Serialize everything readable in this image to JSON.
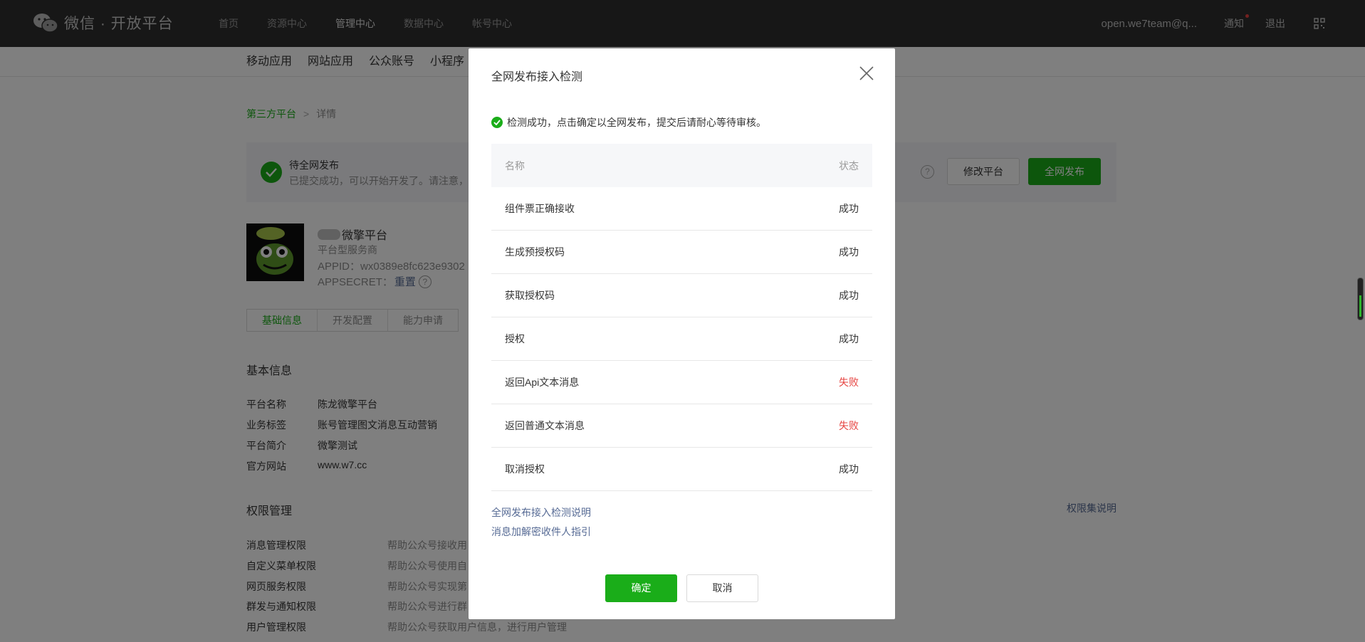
{
  "topbar": {
    "logo_text": "微信 · 开放平台",
    "nav": [
      "首页",
      "资源中心",
      "管理中心",
      "数据中心",
      "帐号中心"
    ],
    "active_nav": "管理中心",
    "account": "open.we7team@q...",
    "notify": "通知",
    "logout": "退出",
    "icons": {
      "logo": "wechat-logo-icon",
      "qr": "qrcode-icon"
    }
  },
  "subnav": [
    "移动应用",
    "网站应用",
    "公众账号",
    "小程序"
  ],
  "breadcrumb": {
    "home": "第三方平台",
    "sep": ">",
    "current": "详情"
  },
  "notice": {
    "title": "待全网发布",
    "desc": "已提交成功，可以开始开发了。请注意，",
    "help": "?",
    "modify_button": "修改平台",
    "publish_button": "全网发布"
  },
  "platform": {
    "name": "微擎平台",
    "type": "平台型服务商",
    "appid": "APPID：wx0389e8fc623e9302",
    "appsecret_label": "APPSECRET：",
    "appsecret_reset": "重置",
    "help": "?"
  },
  "tabs": [
    "基础信息",
    "开发配置",
    "能力申请"
  ],
  "basic_info": {
    "title": "基本信息",
    "rows": [
      {
        "k": "平台名称",
        "v": "陈龙微擎平台"
      },
      {
        "k": "业务标签",
        "v": "账号管理图文消息互动营销"
      },
      {
        "k": "平台简介",
        "v": "微擎测试"
      },
      {
        "k": "官方网站",
        "v": "www.w7.cc"
      }
    ]
  },
  "permissions": {
    "title": "权限管理",
    "help_link": "权限集说明",
    "rows": [
      {
        "k": "消息管理权限",
        "v": "帮助公众号接收用"
      },
      {
        "k": "自定义菜单权限",
        "v": "帮助公众号使用自"
      },
      {
        "k": "网页服务权限",
        "v": "帮助公众号实现第"
      },
      {
        "k": "群发与通知权限",
        "v": "帮助公众号进行群"
      },
      {
        "k": "用户管理权限",
        "v": "帮助公众号获取用户信息，进行用户管理"
      }
    ]
  },
  "modal": {
    "title": "全网发布接入检测",
    "status": "检测成功，点击确定以全网发布，提交后请耐心等待审核。",
    "table_header": {
      "name": "名称",
      "status": "状态"
    },
    "rows": [
      {
        "name": "组件票正确接收",
        "status": "成功",
        "fail": false
      },
      {
        "name": "生成预授权码",
        "status": "成功",
        "fail": false
      },
      {
        "name": "获取授权码",
        "status": "成功",
        "fail": false
      },
      {
        "name": "授权",
        "status": "成功",
        "fail": false
      },
      {
        "name": "返回Api文本消息",
        "status": "失败",
        "fail": true
      },
      {
        "name": "返回普通文本消息",
        "status": "失败",
        "fail": true
      },
      {
        "name": "取消授权",
        "status": "成功",
        "fail": false
      }
    ],
    "link1": "全网发布接入检测说明",
    "link2": "消息加解密收件人指引",
    "ok_button": "确定",
    "cancel_button": "取消"
  },
  "colors": {
    "brand_green": "#1aad19",
    "fail_red": "#e64340",
    "link_blue": "#576b95"
  }
}
